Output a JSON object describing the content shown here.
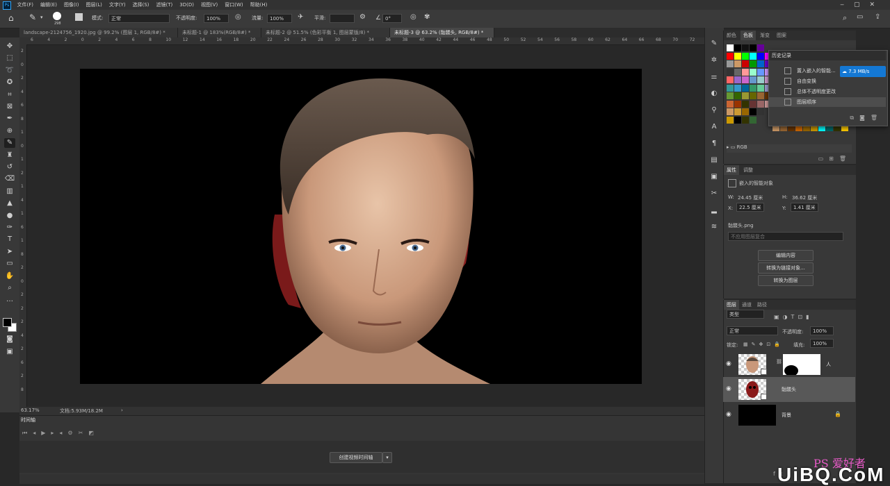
{
  "menu": [
    "文件(F)",
    "编辑(E)",
    "图像(I)",
    "图层(L)",
    "文字(Y)",
    "选择(S)",
    "滤镜(T)",
    "3D(D)",
    "视图(V)",
    "窗口(W)",
    "帮助(H)"
  ],
  "options": {
    "brush_size": "298",
    "mode_label": "模式:",
    "mode_value": "正常",
    "opacity_label": "不透明度:",
    "opacity_value": "100%",
    "flow_label": "流量:",
    "flow_value": "100%",
    "smooth_label": "平滑:",
    "angle_value": "0°"
  },
  "tabs": [
    {
      "label": "landscape-2124756_1920.jpg @ 99.2% (图层 1, RGB/8#) *",
      "active": false
    },
    {
      "label": "未标题-1 @ 183%(RGB/8#) *",
      "active": false
    },
    {
      "label": "未标题-2 @ 51.5% (色彩平衡 1, 图层蒙版/8) *",
      "active": false
    },
    {
      "label": "未标题-3 @ 63.2% (骷髅头, RGB/8#) *",
      "active": true
    }
  ],
  "ruler_top": [
    "6",
    "4",
    "2",
    "0",
    "2",
    "4",
    "6",
    "8",
    "10",
    "12",
    "14",
    "16",
    "18",
    "20",
    "22",
    "24",
    "26",
    "28",
    "30",
    "32",
    "34",
    "36",
    "38",
    "40",
    "42",
    "44",
    "46",
    "48",
    "50",
    "52",
    "54",
    "56",
    "58",
    "60",
    "62",
    "64",
    "66",
    "68",
    "70",
    "72"
  ],
  "ruler_left": [
    "2",
    "0",
    "2",
    "4",
    "6",
    "8",
    "1",
    "0",
    "1",
    "2",
    "1",
    "4",
    "1",
    "6",
    "1",
    "8",
    "2",
    "0",
    "2",
    "2",
    "2",
    "4",
    "2",
    "6",
    "2",
    "8"
  ],
  "status": {
    "zoom": "63.17%",
    "doc": "文档:5.93M/18.2M"
  },
  "timeline": {
    "title": "时间轴",
    "create_button": "创建视频时间轴"
  },
  "color_panel": {
    "tabs": [
      "颜色",
      "色板",
      "渐变",
      "图案"
    ],
    "active": "色板",
    "rgb_group": "RGB"
  },
  "swatches": [
    [
      "#ffffff",
      "#000000",
      "#111111",
      "#000000",
      "#660099"
    ],
    [
      "#ff0000",
      "#ffff00",
      "#00ff00",
      "#00ffff",
      "#0000ff",
      "#ff00ff"
    ],
    [
      "#999999",
      "#cc9966",
      "#cc0000",
      "#009900",
      "#0066cc",
      "#6600cc"
    ],
    [
      "#333333",
      "#666666",
      "#ff9999",
      "#99ffcc",
      "#6699ff",
      "#cc99ff"
    ],
    [
      "#ff6666",
      "#9966cc",
      "#cc66cc",
      "#6699cc",
      "#99cccc",
      "#cc99cc"
    ],
    [
      "#339999",
      "#3399cc",
      "#006699",
      "#339966",
      "#66cc99",
      "#9999cc"
    ],
    [
      "#669933",
      "#336600",
      "#999933",
      "#666600",
      "#996633",
      "#663300"
    ],
    [
      "#cc6633",
      "#993300",
      "#333300",
      "#663333",
      "#996666",
      "#cc9999"
    ],
    [
      "#cc9966",
      "#cc9933",
      "#996600",
      "#000000",
      "#333333"
    ],
    [
      "#cc9900",
      "#000000",
      "#333300",
      "#336633"
    ]
  ],
  "swatches_extra": [
    "#cc9966",
    "#996633",
    "#663300",
    "#cc6600",
    "#996600",
    "#cc9900",
    "#00ffff",
    "#006666",
    "#333300",
    "#ffcc00"
  ],
  "history": {
    "title": "历史记录",
    "items": [
      {
        "label": "置入嵌入的智能...",
        "active": false
      },
      {
        "label": "自由变换",
        "active": false
      },
      {
        "label": "总体不透明度更改",
        "active": false
      },
      {
        "label": "图层顺序",
        "active": true
      }
    ],
    "speed": "7.3 MB/s"
  },
  "properties": {
    "tabs": [
      "属性",
      "调整"
    ],
    "type": "嵌入的智能对象",
    "w_label": "W:",
    "w_value": "24.45 厘米",
    "h_label": "H:",
    "h_value": "36.62 厘米",
    "x_label": "X:",
    "x_value": "22.5 厘米",
    "y_label": "Y:",
    "y_value": "1.41 厘米",
    "file": "骷髅头.png",
    "comp": "不应用图层复合",
    "buttons": [
      "编辑内容",
      "转换为链接对象...",
      "转换为图层"
    ]
  },
  "layers_panel": {
    "tabs": [
      "图层",
      "通道",
      "路径"
    ],
    "filter": "类型",
    "blend": "正常",
    "opacity_label": "不透明度:",
    "opacity": "100%",
    "lock_label": "锁定:",
    "fill_label": "填充:",
    "fill": "100%",
    "layers": [
      {
        "name": "人",
        "active": false
      },
      {
        "name": "骷髅头",
        "active": true
      },
      {
        "name": "背景",
        "active": false
      }
    ]
  },
  "watermark": "UiBQ.CoM",
  "watermark_small": "PS 爱好者",
  "colors": {
    "accent": "#1473e6",
    "bg": "#282828",
    "panel": "#383838"
  }
}
